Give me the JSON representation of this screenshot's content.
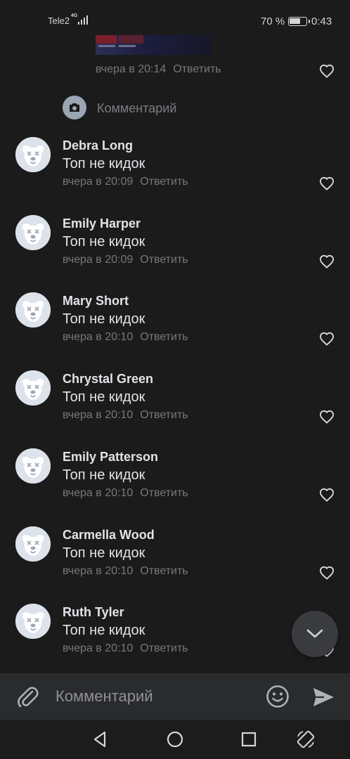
{
  "status_bar": {
    "carrier": "Tele2",
    "network": "4G",
    "battery_percent": "70 %",
    "battery_level": 0.7,
    "time": "0:43"
  },
  "previous_comment": {
    "time": "вчера в 20:14",
    "reply_label": "Ответить"
  },
  "new_comment": {
    "placeholder": "Комментарий"
  },
  "comments": [
    {
      "author": "Debra Long",
      "text": "Топ не кидок",
      "time": "вчера в 20:09",
      "reply_label": "Ответить"
    },
    {
      "author": "Emily Harper",
      "text": "Топ не кидок",
      "time": "вчера в 20:09",
      "reply_label": "Ответить"
    },
    {
      "author": "Mary Short",
      "text": "Топ не кидок",
      "time": "вчера в 20:10",
      "reply_label": "Ответить"
    },
    {
      "author": "Chrystal Green",
      "text": "Топ не кидок",
      "time": "вчера в 20:10",
      "reply_label": "Ответить"
    },
    {
      "author": "Emily Patterson",
      "text": "Топ не кидок",
      "time": "вчера в 20:10",
      "reply_label": "Ответить"
    },
    {
      "author": "Carmella Wood",
      "text": "Топ не кидок",
      "time": "вчера в 20:10",
      "reply_label": "Ответить"
    },
    {
      "author": "Ruth Tyler",
      "text": "Топ не кидок",
      "time": "вчера в 20:10",
      "reply_label": "Ответить"
    }
  ],
  "composer": {
    "placeholder": "Комментарий"
  },
  "icons": {
    "attach": "paperclip-icon",
    "emoji": "smiley-icon",
    "send": "send-icon",
    "like": "heart-outline-icon",
    "camera": "camera-icon",
    "scroll_down": "chevron-down-icon",
    "avatar": "deactivated-dog-avatar",
    "nav_back": "triangle-back-icon",
    "nav_home": "circle-home-icon",
    "nav_recents": "square-recents-icon",
    "nav_rotate": "rotate-icon"
  },
  "colors": {
    "background": "#1b1b1c",
    "text_primary": "#e1e3e6",
    "text_secondary": "#76787a",
    "composer_bg": "#2a2b2d",
    "avatar_bg": "#dde3ea"
  }
}
